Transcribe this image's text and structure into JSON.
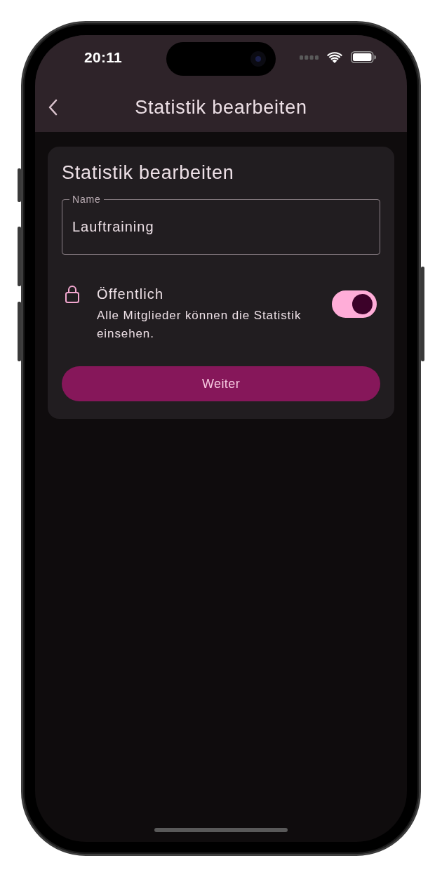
{
  "status_bar": {
    "time": "20:11"
  },
  "nav_bar": {
    "title": "Statistik bearbeiten"
  },
  "card": {
    "title": "Statistik bearbeiten",
    "name_field": {
      "label": "Name",
      "value": "Lauftraining"
    },
    "setting": {
      "title": "Öffentlich",
      "description": "Alle Mitglieder können die Statistik einsehen.",
      "on": true
    },
    "button": {
      "label": "Weiter"
    }
  }
}
